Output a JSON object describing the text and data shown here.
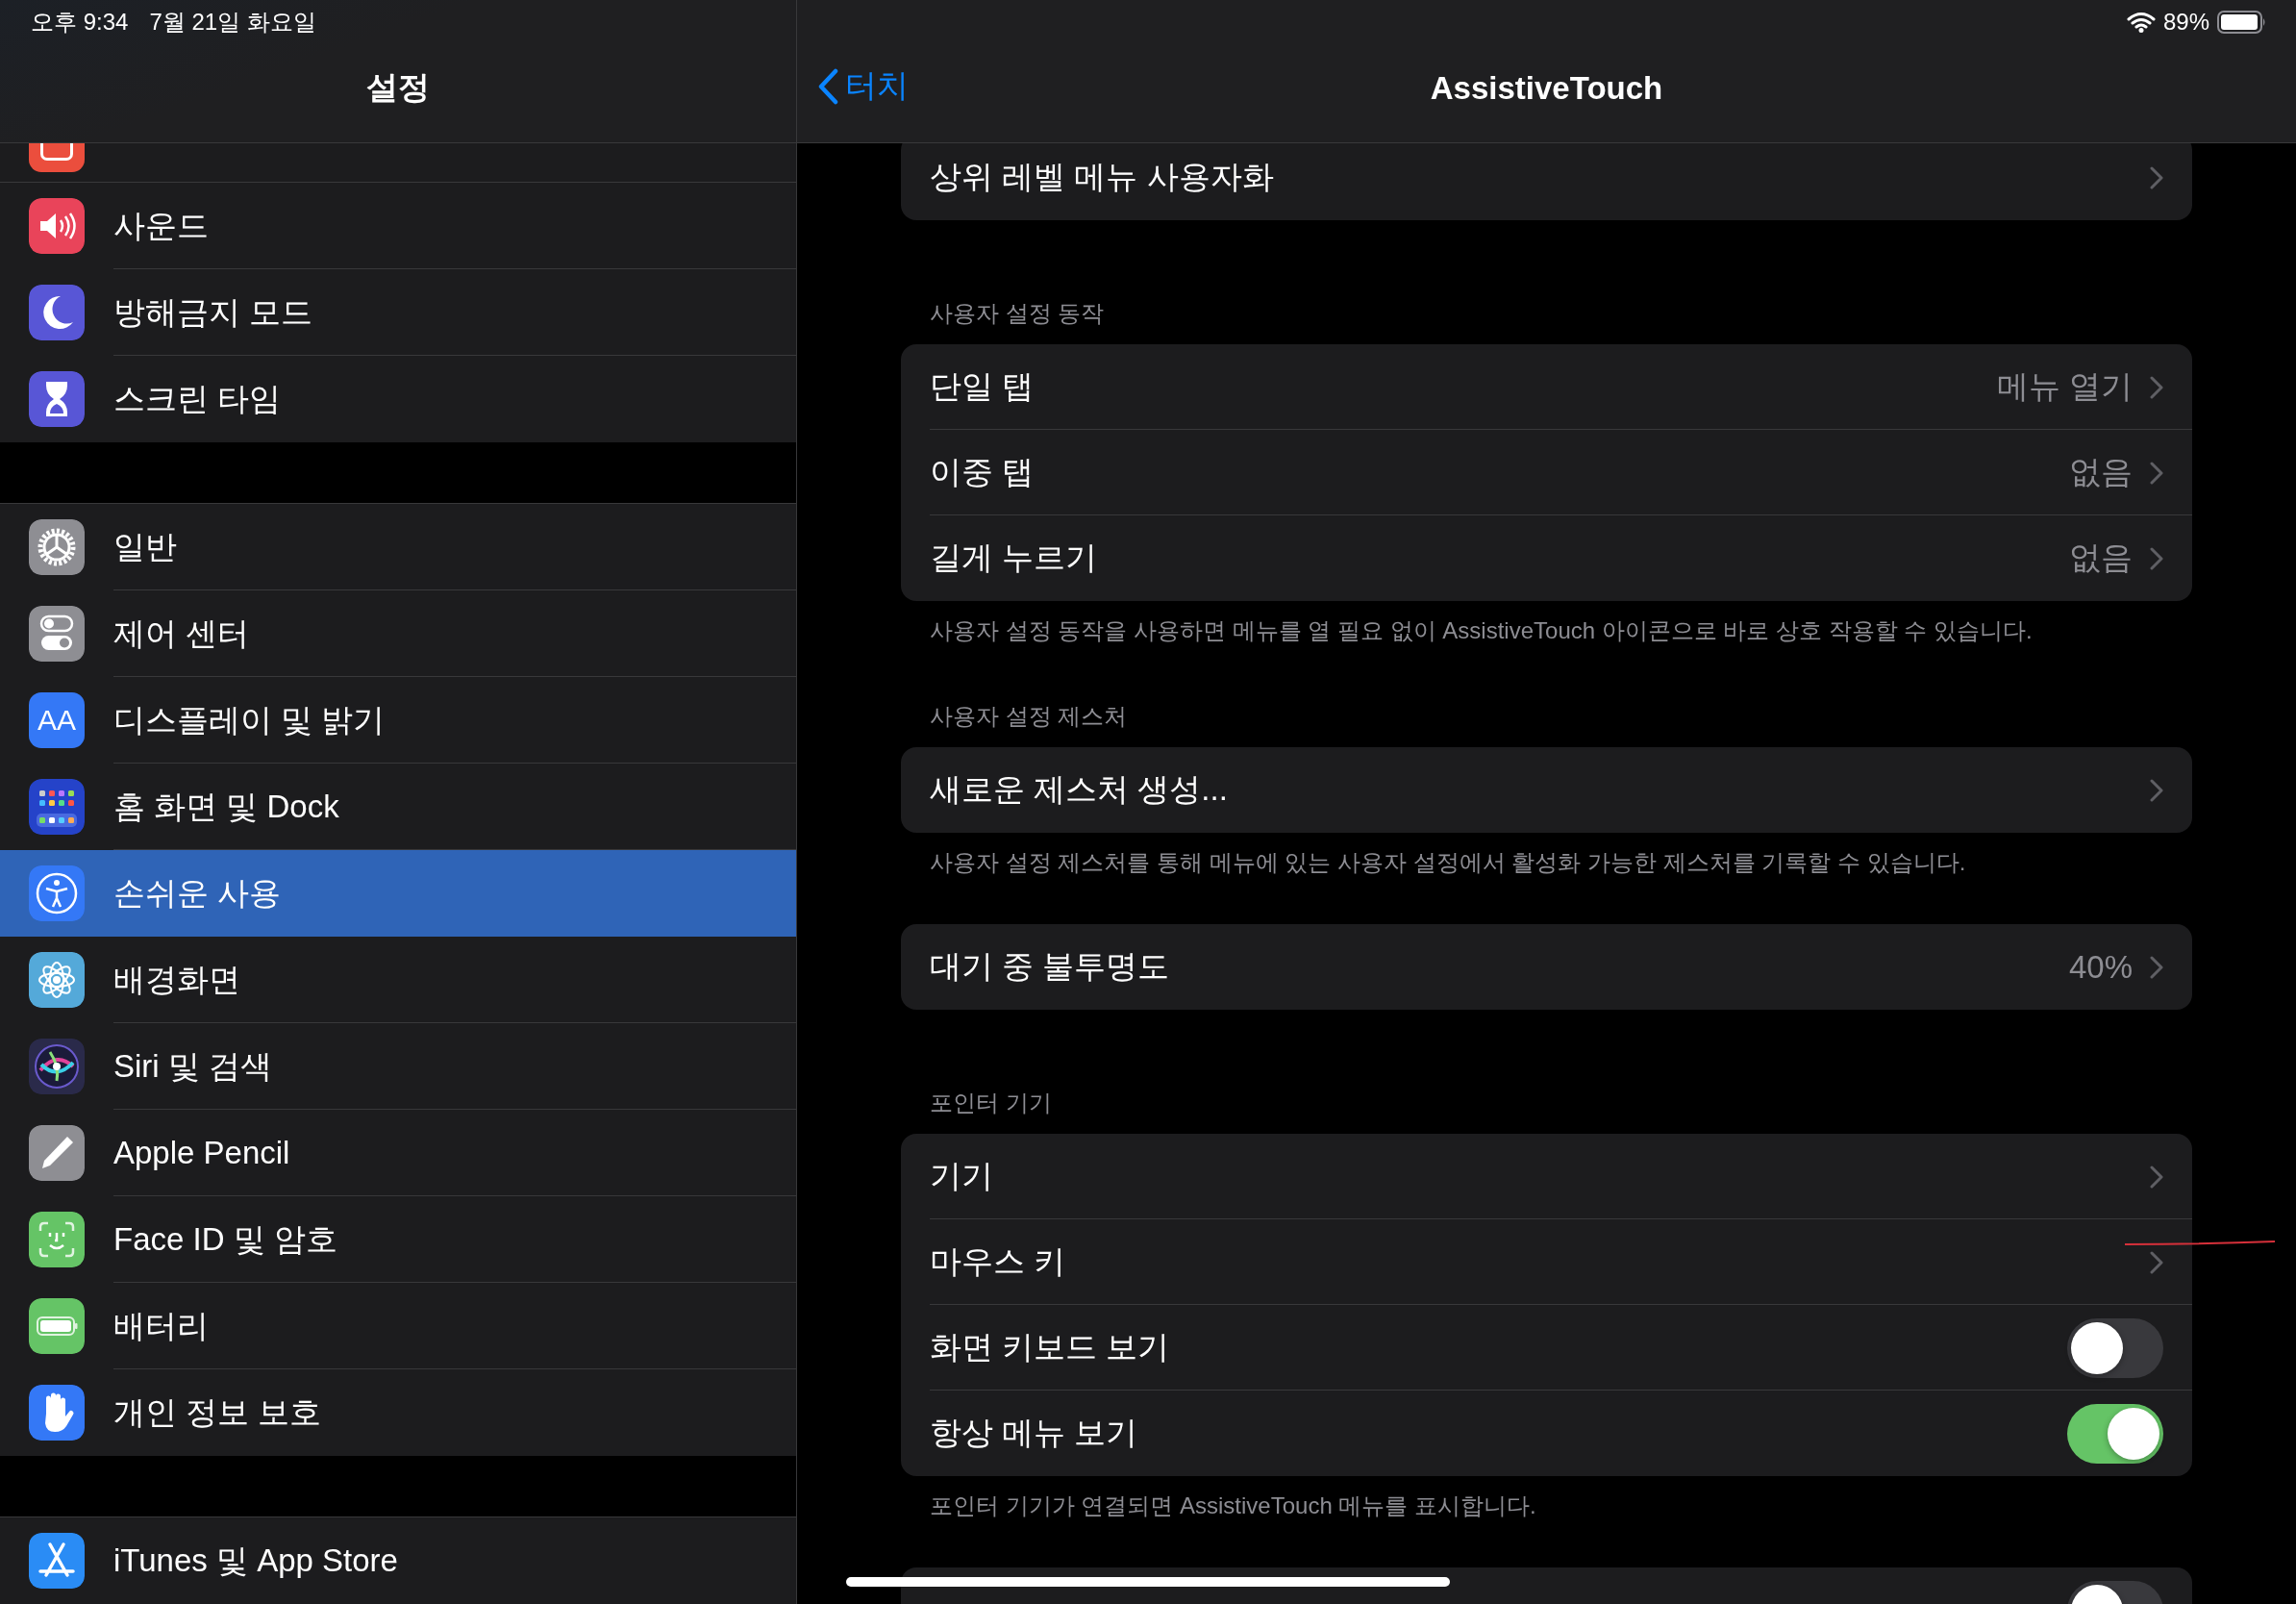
{
  "status_bar": {
    "time": "오후 9:34",
    "date": "7월 21일 화요일",
    "battery": "89%"
  },
  "sidebar": {
    "title": "설정",
    "groups": [
      {
        "items": [
          {
            "label": "사운드",
            "selected": false
          },
          {
            "label": "방해금지 모드",
            "selected": false
          },
          {
            "label": "스크린 타임",
            "selected": false
          }
        ]
      },
      {
        "items": [
          {
            "label": "일반",
            "selected": false
          },
          {
            "label": "제어 센터",
            "selected": false
          },
          {
            "label": "디스플레이 및 밝기",
            "selected": false,
            "icon_text": "AA"
          },
          {
            "label": "홈 화면 및 Dock",
            "selected": false
          },
          {
            "label": "손쉬운 사용",
            "selected": true
          },
          {
            "label": "배경화면",
            "selected": false
          },
          {
            "label": "Siri 및 검색",
            "selected": false
          },
          {
            "label": "Apple Pencil",
            "selected": false
          },
          {
            "label": "Face ID 및 암호",
            "selected": false
          },
          {
            "label": "배터리",
            "selected": false
          },
          {
            "label": "개인 정보 보호",
            "selected": false
          }
        ]
      },
      {
        "items": [
          {
            "label": "iTunes 및 App Store",
            "selected": false
          }
        ]
      }
    ]
  },
  "detail": {
    "back": "터치",
    "title": "AssistiveTouch",
    "sections": [
      {
        "rows": [
          {
            "kind": "link",
            "label": "상위 레벨 메뉴 사용자화"
          }
        ]
      },
      {
        "header": "사용자 설정 동작",
        "footer": "사용자 설정 동작을 사용하면 메뉴를 열 필요 없이 AssistiveTouch 아이콘으로 바로 상호 작용할 수 있습니다.",
        "rows": [
          {
            "kind": "link",
            "label": "단일 탭",
            "value": "메뉴 열기"
          },
          {
            "kind": "link",
            "label": "이중 탭",
            "value": "없음"
          },
          {
            "kind": "link",
            "label": "길게 누르기",
            "value": "없음"
          }
        ]
      },
      {
        "header": "사용자 설정 제스처",
        "footer": "사용자 설정 제스처를 통해 메뉴에 있는 사용자 설정에서 활성화 가능한 제스처를 기록할 수 있습니다.",
        "rows": [
          {
            "kind": "link",
            "label": "새로운 제스처 생성..."
          }
        ]
      },
      {
        "rows": [
          {
            "kind": "link",
            "label": "대기 중 불투명도",
            "value": "40%"
          }
        ]
      },
      {
        "header": "포인터 기기",
        "footer": "포인터 기기가 연결되면 AssistiveTouch 메뉴를 표시합니다.",
        "rows": [
          {
            "kind": "link",
            "label": "기기"
          },
          {
            "kind": "link",
            "label": "마우스 키"
          },
          {
            "kind": "toggle",
            "label": "화면 키보드 보기",
            "on": false
          },
          {
            "kind": "toggle",
            "label": "항상 메뉴 보기",
            "on": true
          }
        ]
      },
      {
        "rows": [
          {
            "kind": "toggle",
            "on": false
          }
        ]
      }
    ]
  }
}
